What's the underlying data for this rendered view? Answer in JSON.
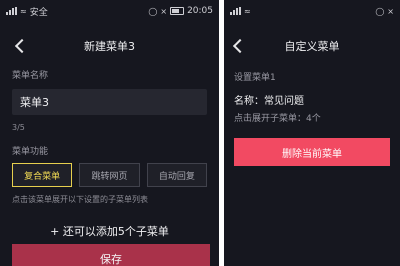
{
  "left": {
    "status": {
      "carrier": "安全",
      "time": "20:05"
    },
    "title": "新建菜单3",
    "name_label": "菜单名称",
    "name_value": "菜单3",
    "char_count": "3/5",
    "func_label": "菜单功能",
    "func_options": [
      "复合菜单",
      "跳转网页",
      "自动回复"
    ],
    "func_hint": "点击该菜单展开以下设置的子菜单列表",
    "add_sub": "+ 还可以添加5个子菜单",
    "save": "保存"
  },
  "right": {
    "title": "自定义菜单",
    "setting_label": "设置菜单1",
    "name_line": "名称：常见问题",
    "sub_count": "点击展开子菜单：4个",
    "delete": "删除当前菜单"
  },
  "colors": {
    "bg": "#16171f",
    "accent_yellow": "#e6cf4e",
    "save_red": "#a9324a",
    "delete_red": "#f24a62"
  },
  "icons": [
    "back-chevron-icon",
    "signal-icon",
    "wifi-icon",
    "battery-icon"
  ]
}
